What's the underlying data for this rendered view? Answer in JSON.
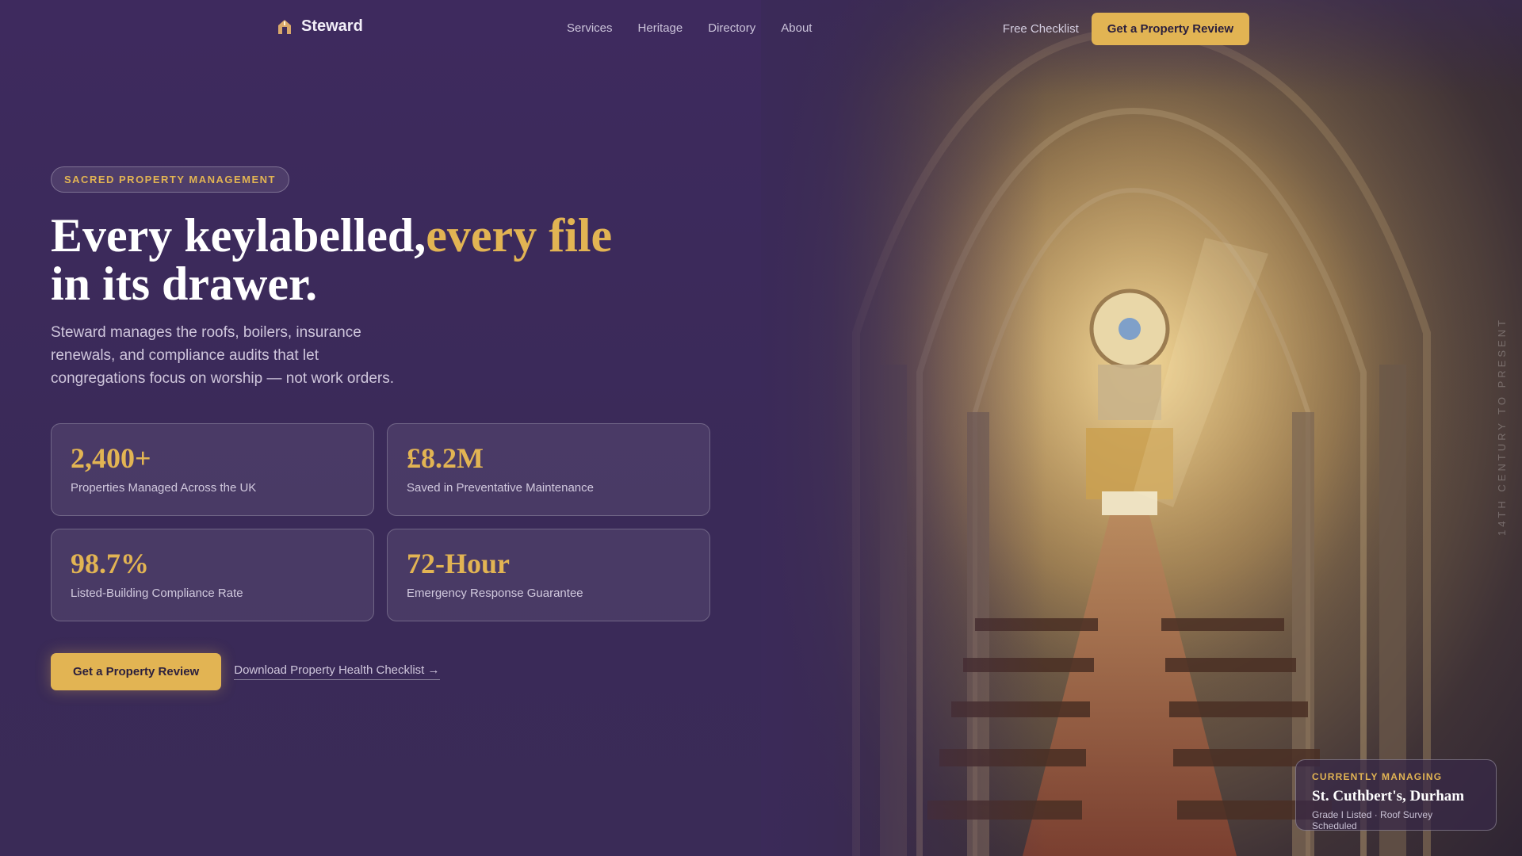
{
  "nav": {
    "brand": "Steward",
    "links": [
      "Services",
      "Heritage",
      "Directory",
      "About"
    ],
    "checklist_link": "Free Checklist",
    "cta": "Get a Property Review"
  },
  "hero": {
    "badge": "SACRED PROPERTY MANAGEMENT",
    "headline_part1": "Every keylabelled,",
    "headline_accent": "every file",
    "headline_part2": "in its drawer.",
    "lede": "Steward manages the roofs, boilers, insurance renewals, and compliance audits that let congregations focus on worship — not work orders.",
    "stats": [
      {
        "value": "2,400+",
        "label": "Properties Managed Across the UK"
      },
      {
        "value": "£8.2M",
        "label": "Saved in Preventative Maintenance"
      },
      {
        "value": "98.7%",
        "label": "Listed-Building Compliance Rate"
      },
      {
        "value": "72-Hour",
        "label": "Emergency Response Guarantee"
      }
    ],
    "cta": "Get a Property Review",
    "secondary_link": "Download Property Health Checklist →"
  },
  "image": {
    "side_caption": "14TH CENTURY TO PRESENT"
  },
  "managing_card": {
    "caption": "CURRENTLY MANAGING",
    "name": "St. Cuthbert's, Durham",
    "details": "Grade I Listed · Roof Survey Scheduled"
  },
  "colors": {
    "background": "#3d2b5c",
    "accent": "#e2b453"
  }
}
